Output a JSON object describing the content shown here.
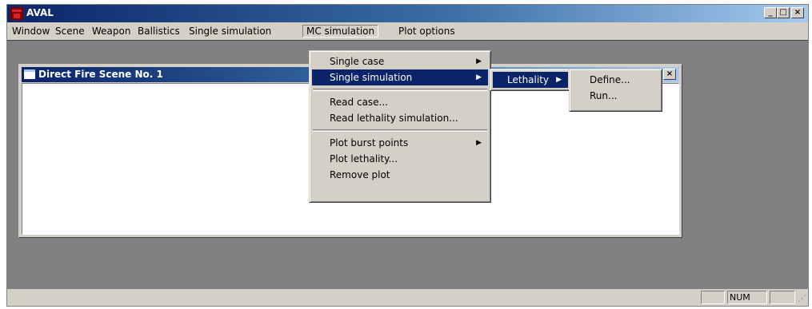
{
  "app": {
    "title": "AVAL"
  },
  "menubar": [
    "Window",
    "Scene",
    "Weapon",
    "Ballistics",
    "Single simulation",
    "MC simulation",
    "Plot options"
  ],
  "active_menu": "MC simulation",
  "window_controls": {
    "minimize": "_",
    "maximize": "□",
    "close": "×"
  },
  "child_window": {
    "title": "Direct Fire Scene No. 1",
    "close": "×"
  },
  "mc_menu": {
    "group1": [
      "Single case",
      "Single simulation"
    ],
    "group2": [
      "Read case...",
      "Read lethality simulation..."
    ],
    "group3": [
      "Plot burst points",
      "Plot lethality...",
      "Remove plot"
    ]
  },
  "submenu1": {
    "item": "Lethality"
  },
  "submenu2": {
    "items": [
      "Define...",
      "Run..."
    ]
  },
  "statusbar": {
    "num": "NUM"
  },
  "colors": {
    "title_dark": "#0a246a",
    "title_light": "#a6caf0",
    "face": "#d4d0c8",
    "mdi_bg": "#808080",
    "highlight": "#0a246a"
  }
}
